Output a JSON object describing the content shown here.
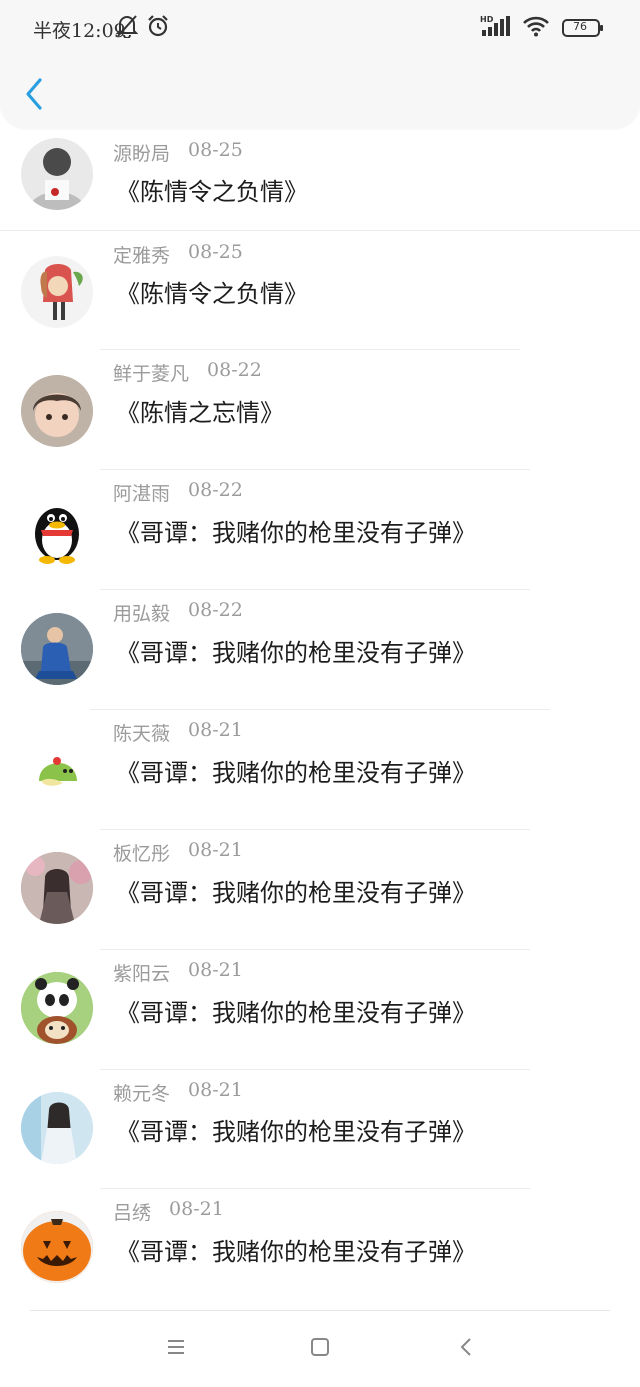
{
  "status_bar": {
    "time": "半夜12:09",
    "battery": "76",
    "icons": [
      "bell-off-icon",
      "alarm-clock-icon",
      "hd-signal-icon",
      "wifi-icon",
      "battery-icon"
    ]
  },
  "header": {
    "back_icon": "chevron-left-icon"
  },
  "items": [
    {
      "name": "源盼局",
      "date": "08-25",
      "title": "《陈情令之负情》"
    },
    {
      "name": "定雅秀",
      "date": "08-25",
      "title": "《陈情令之负情》"
    },
    {
      "name": "鲜于菱凡",
      "date": "08-22",
      "title": "《陈情之忘情》"
    },
    {
      "name": "阿湛雨",
      "date": "08-22",
      "title": "《哥谭：我赌你的枪里没有子弹》"
    },
    {
      "name": "用弘毅",
      "date": "08-22",
      "title": "《哥谭：我赌你的枪里没有子弹》"
    },
    {
      "name": "陈天薇",
      "date": "08-21",
      "title": "《哥谭：我赌你的枪里没有子弹》"
    },
    {
      "name": "板忆彤",
      "date": "08-21",
      "title": "《哥谭：我赌你的枪里没有子弹》"
    },
    {
      "name": "紫阳云",
      "date": "08-21",
      "title": "《哥谭：我赌你的枪里没有子弹》"
    },
    {
      "name": "赖元冬",
      "date": "08-21",
      "title": "《哥谭：我赌你的枪里没有子弹》"
    },
    {
      "name": "吕绣",
      "date": "08-21",
      "title": "《哥谭：我赌你的枪里没有子弹》"
    }
  ],
  "nav_bar": {
    "icons": [
      "menu-icon",
      "home-square-icon",
      "back-triangle-icon"
    ]
  },
  "colors": {
    "accent": "#2a9fe0",
    "meta_text": "#9b9b9b",
    "title_text": "#1d1d1d"
  }
}
